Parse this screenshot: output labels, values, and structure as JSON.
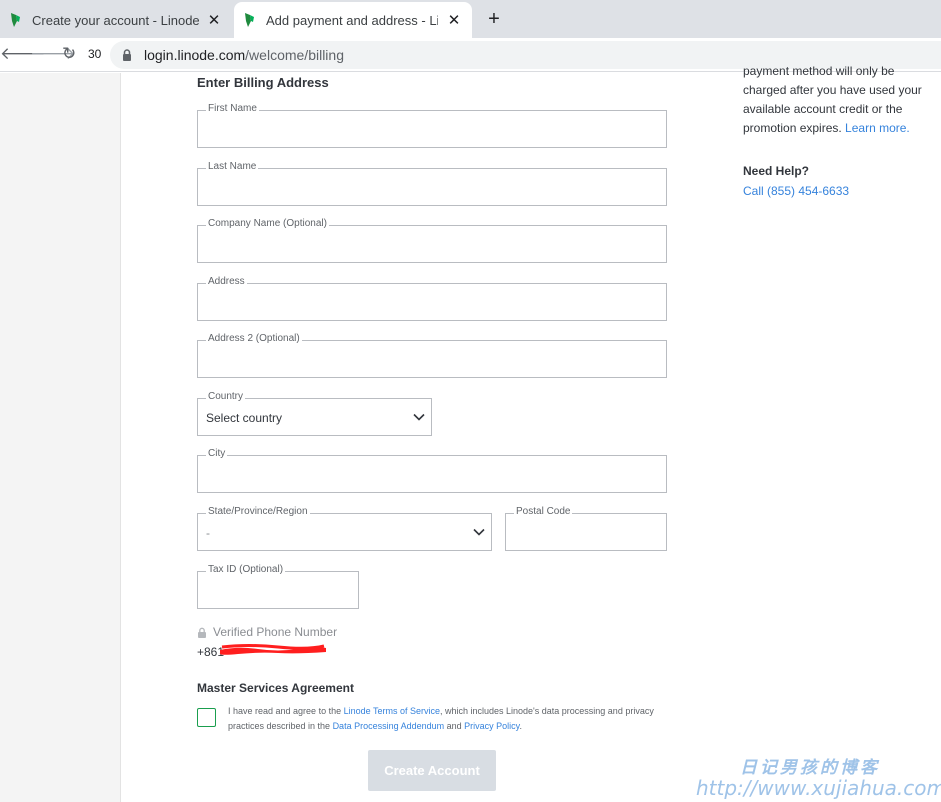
{
  "browser": {
    "tabs": [
      {
        "title": "Create your account - Linode",
        "close": "✕"
      },
      {
        "title": "Add payment and address - Linode",
        "close": "✕"
      }
    ],
    "new_tab": "+",
    "zoom": "30",
    "url_host": "login.linode.com",
    "url_path": "/welcome/billing",
    "back_icon": "🡐",
    "forward_icon": "🡒",
    "reload_icon": "↻"
  },
  "form": {
    "section_title": "Enter Billing Address",
    "fields": {
      "first_name": {
        "label": "First Name",
        "value": ""
      },
      "last_name": {
        "label": "Last Name",
        "value": ""
      },
      "company": {
        "label": "Company Name (Optional)",
        "value": ""
      },
      "address": {
        "label": "Address",
        "value": ""
      },
      "address2": {
        "label": "Address 2 (Optional)",
        "value": ""
      },
      "country": {
        "label": "Country",
        "value": "Select country"
      },
      "city": {
        "label": "City",
        "value": ""
      },
      "state": {
        "label": "State/Province/Region",
        "value": "-"
      },
      "postal": {
        "label": "Postal Code",
        "value": ""
      },
      "tax_id": {
        "label": "Tax ID (Optional)",
        "value": ""
      }
    },
    "phone_label": "Verified Phone Number",
    "phone_value": "+861",
    "msa_title": "Master Services Agreement",
    "msa_text_1": "I have read and agree to the ",
    "msa_link_tos": "Linode Terms of Service",
    "msa_text_2": ", which includes Linode's data processing and privacy practices described in the ",
    "msa_link_dpa": "Data Processing Addendum",
    "msa_text_3": " and ",
    "msa_link_privacy": "Privacy Policy",
    "msa_text_4": ".",
    "create_button": "Create Account"
  },
  "right": {
    "text_partial": "payment method will only be charged after you have used your available account credit or the promotion expires. ",
    "learn_more": "Learn more.",
    "help_title": "Need Help?",
    "help_phone": "Call (855) 454-6633"
  },
  "watermark": {
    "line1": "日记男孩的博客",
    "line2": "http://www.xujiahua.com"
  },
  "colors": {
    "accent": "#3683dc",
    "checkbox_border": "#1a9e4e",
    "button_disabled": "#d8dde3",
    "redaction": "#ff1e1e"
  }
}
